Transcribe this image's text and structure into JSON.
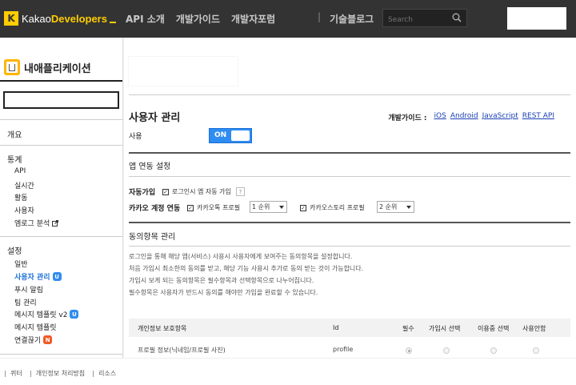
{
  "header": {
    "logo_prefix": "Kakao",
    "logo_bold": "Developers",
    "nav": [
      "API 소개",
      "개발가이드",
      "개발자포럼"
    ],
    "divider": "|",
    "blog": "기술블로그",
    "search_placeholder": "Search"
  },
  "sidebar": {
    "app_title": "내애플리케이션",
    "overview": "개요",
    "stats": {
      "heading": "통계",
      "items": [
        "API",
        "실시간",
        "활동",
        "사용자",
        "엠로그 분석"
      ]
    },
    "settings": {
      "heading": "설정",
      "items": [
        "일반",
        "사용자 관리",
        "푸시 알림",
        "팀 관리",
        "메시지 템플릿 v2",
        "메시지 템플릿",
        "연결끊기"
      ],
      "badge_u": "U",
      "badge_n": "N"
    }
  },
  "main": {
    "page_title": "사용자 관리",
    "guide_label": "개발가이드 :",
    "guide_links": [
      "iOS",
      "Android",
      "JavaScript",
      "REST API"
    ],
    "use_label": "사용",
    "toggle_label": "ON",
    "app_link_title": "앱 연동 설정",
    "auto_join_label": "자동가입",
    "auto_join_option": "로그인시 앱 자동 가입",
    "help_mark": "?",
    "account_link_label": "카카오 계정 연동",
    "kakaotalk_profile": "카카오톡 프로필",
    "kakaotalk_rank": "1 순위",
    "kakaostory_profile": "카카오스토리 프로필",
    "kakaostory_rank": "2 순위",
    "consent_title": "동의항목 관리",
    "consent_desc": [
      "로그인을 통해 해당 앱(서비스) 사용시 사용자에게 보여주는 동의항목을 설정합니다.",
      "처음 가입시 최소한의 동의를 받고, 해당 기능 사용시 추가로 동의 받는 것이 가능합니다.",
      "가입시 보게 되는 동의항목은 필수항목과 선택항목으로 나누어집니다.",
      "필수항목은 사용자가 반드시 동의를 해야만 가입을 완료할 수 있습니다."
    ],
    "table": {
      "headers": [
        "개인정보 보호항목",
        "Id",
        "필수",
        "가입시 선택",
        "이용중 선택",
        "사용안함"
      ],
      "rows": [
        {
          "name": "프로필 정보(닉네임/프로필 사진)",
          "id": "profile"
        }
      ]
    }
  },
  "footer": {
    "links": [
      "퀴터",
      "개인정보 처리방침",
      "리소스"
    ]
  },
  "colors": {
    "topbar": "#333333",
    "brand_yellow": "#ffcd00",
    "toggle_blue": "#2f8cf0",
    "link_blue": "#1a3fb5"
  }
}
